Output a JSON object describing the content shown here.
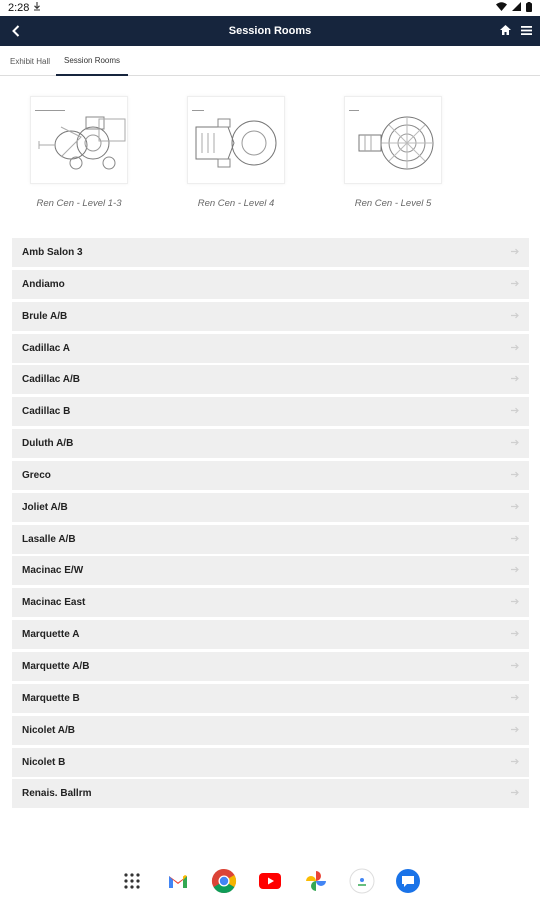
{
  "status": {
    "time": "2:28"
  },
  "app_bar": {
    "title": "Session Rooms"
  },
  "tabs": [
    {
      "label": "Exhibit Hall",
      "active": false
    },
    {
      "label": "Session Rooms",
      "active": true
    }
  ],
  "maps": [
    {
      "caption": "Ren Cen - Level 1-3"
    },
    {
      "caption": "Ren Cen - Level 4"
    },
    {
      "caption": "Ren Cen - Level 5"
    }
  ],
  "rooms": [
    {
      "label": "Amb Salon 3"
    },
    {
      "label": "Andiamo"
    },
    {
      "label": "Brule A/B"
    },
    {
      "label": "Cadillac A"
    },
    {
      "label": "Cadillac A/B"
    },
    {
      "label": "Cadillac B"
    },
    {
      "label": "Duluth A/B"
    },
    {
      "label": "Greco"
    },
    {
      "label": "Joliet A/B"
    },
    {
      "label": "Lasalle A/B"
    },
    {
      "label": "Macinac E/W"
    },
    {
      "label": "Macinac East"
    },
    {
      "label": "Marquette A"
    },
    {
      "label": "Marquette A/B"
    },
    {
      "label": "Marquette B"
    },
    {
      "label": "Nicolet A/B"
    },
    {
      "label": "Nicolet B"
    },
    {
      "label": "Renais. Ballrm"
    }
  ],
  "dock": [
    "apps-grid-icon",
    "gmail-icon",
    "chrome-icon",
    "youtube-icon",
    "photos-icon",
    "assistant-icon",
    "messages-icon"
  ],
  "colors": {
    "app_bar": "#16253d",
    "row_bg": "#efefef"
  }
}
